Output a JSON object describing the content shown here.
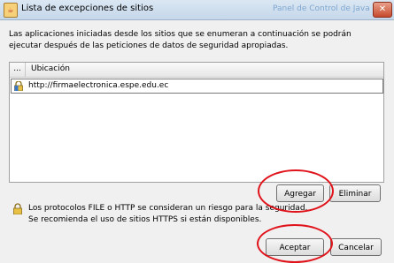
{
  "window": {
    "title": "Lista de excepciones de sitios",
    "background_text": "Panel de Control de Java"
  },
  "description": "Las aplicaciones iniciadas desde los sitios que se enumeran a continuación se podrán ejecutar después de las peticiones de datos de seguridad apropiadas.",
  "table": {
    "columns": [
      "...",
      "Ubicación"
    ],
    "rows": [
      {
        "url": "http://firmaelectronica.espe.edu.ec"
      }
    ]
  },
  "buttons": {
    "add": "Agregar",
    "remove": "Eliminar",
    "accept": "Aceptar",
    "cancel": "Cancelar"
  },
  "info": {
    "line1": "Los protocolos FILE o HTTP se consideran un riesgo para la seguridad.",
    "line2": "Se recomienda el uso de sitios HTTPS si están disponibles."
  },
  "colors": {
    "annotation": "#e0121a",
    "title_bar": "#c5d7ea"
  }
}
